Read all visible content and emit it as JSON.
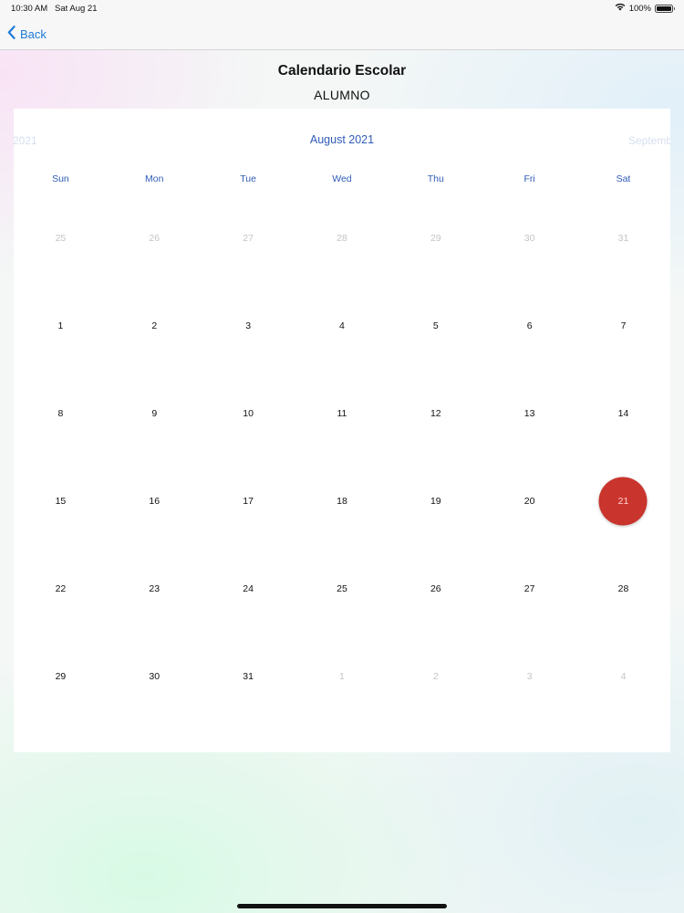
{
  "status_bar": {
    "time": "10:30 AM",
    "date": "Sat Aug 21",
    "battery_text": "100%",
    "battery_level": 1.0
  },
  "nav": {
    "back_label": "Back"
  },
  "page": {
    "title": "Calendario Escolar",
    "subtitle": "ALUMNO"
  },
  "calendar": {
    "prev_month_label": "2021",
    "current_month_label": "August 2021",
    "next_month_label": "September",
    "weekdays": [
      "Sun",
      "Mon",
      "Tue",
      "Wed",
      "Thu",
      "Fri",
      "Sat"
    ],
    "weeks": [
      [
        {
          "n": "25",
          "m": true
        },
        {
          "n": "26",
          "m": true
        },
        {
          "n": "27",
          "m": true
        },
        {
          "n": "28",
          "m": true
        },
        {
          "n": "29",
          "m": true
        },
        {
          "n": "30",
          "m": true
        },
        {
          "n": "31",
          "m": true
        }
      ],
      [
        {
          "n": "1"
        },
        {
          "n": "2"
        },
        {
          "n": "3"
        },
        {
          "n": "4"
        },
        {
          "n": "5"
        },
        {
          "n": "6"
        },
        {
          "n": "7"
        }
      ],
      [
        {
          "n": "8"
        },
        {
          "n": "9"
        },
        {
          "n": "10"
        },
        {
          "n": "11"
        },
        {
          "n": "12"
        },
        {
          "n": "13"
        },
        {
          "n": "14"
        }
      ],
      [
        {
          "n": "15"
        },
        {
          "n": "16"
        },
        {
          "n": "17"
        },
        {
          "n": "18"
        },
        {
          "n": "19"
        },
        {
          "n": "20"
        },
        {
          "n": "21",
          "today": true
        }
      ],
      [
        {
          "n": "22"
        },
        {
          "n": "23"
        },
        {
          "n": "24"
        },
        {
          "n": "25"
        },
        {
          "n": "26"
        },
        {
          "n": "27"
        },
        {
          "n": "28"
        }
      ],
      [
        {
          "n": "29"
        },
        {
          "n": "30"
        },
        {
          "n": "31"
        },
        {
          "n": "1",
          "m": true
        },
        {
          "n": "2",
          "m": true
        },
        {
          "n": "3",
          "m": true
        },
        {
          "n": "4",
          "m": true
        }
      ]
    ]
  },
  "colors": {
    "accent": "#2f5cb7",
    "back_link": "#1f7bd8",
    "today": "#c9342d",
    "muted_day": "#c4c4c6"
  }
}
